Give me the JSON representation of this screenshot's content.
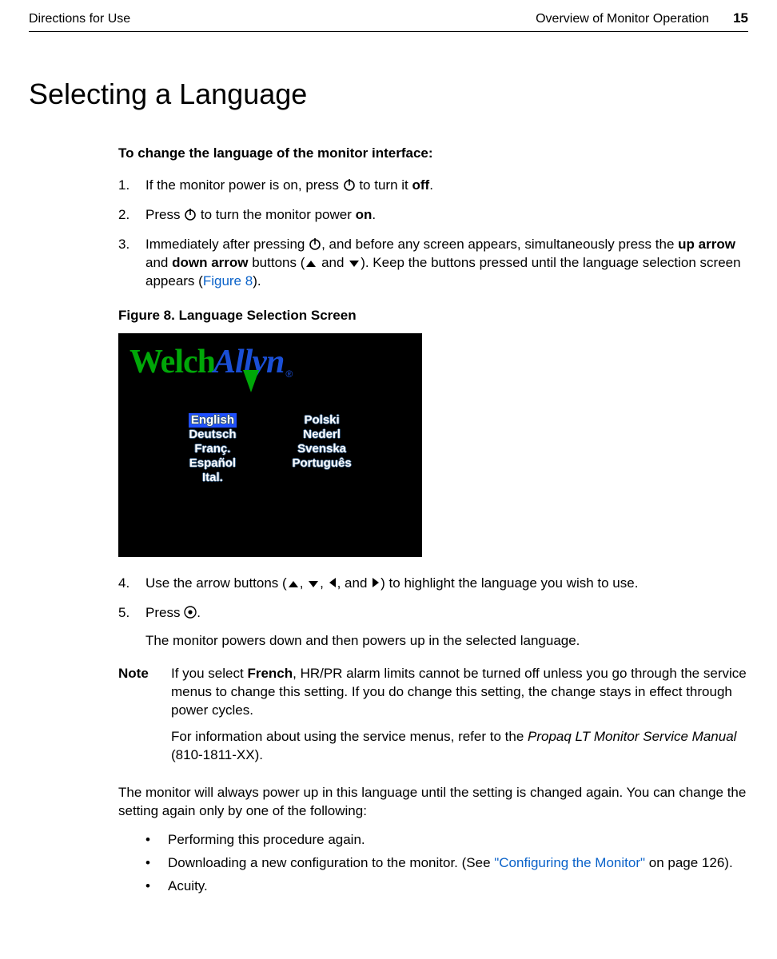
{
  "header": {
    "left": "Directions for Use",
    "right": "Overview of Monitor Operation",
    "pagenum": "15"
  },
  "title": "Selecting a Language",
  "intro": "To change the language of the monitor interface:",
  "steps": {
    "s1": {
      "num": "1.",
      "pre": "If the monitor power is on, press ",
      "post": " to turn it ",
      "bold": "off",
      "end": "."
    },
    "s2": {
      "num": "2.",
      "pre": "Press ",
      "post": " to turn the monitor power ",
      "bold": "on",
      "end": "."
    },
    "s3": {
      "num": "3.",
      "a": "Immediately after pressing ",
      "b": ", and before any screen appears, simultaneously press the ",
      "bold1": "up arrow",
      "c": " and ",
      "bold2": "down arrow",
      "d": " buttons (",
      "e": " and ",
      "f": "). Keep the buttons pressed until the language selection screen appears (",
      "link": "Figure 8",
      "g": ")."
    },
    "s4": {
      "num": "4.",
      "a": "Use the arrow buttons (",
      "b": ", ",
      "c": ", ",
      "d": ", and ",
      "e": ") to highlight the language you wish to use."
    },
    "s5": {
      "num": "5.",
      "a": "Press ",
      "b": ".",
      "sub": "The monitor powers down and then powers up in the selected language."
    }
  },
  "figcap": {
    "label": "Figure 8.  ",
    "title": "Language Selection Screen"
  },
  "logo": {
    "welch": "Welch",
    "allyn": "Allyn",
    "reg": "®"
  },
  "langs": {
    "col1": [
      "English",
      "Deutsch",
      "Franç.",
      "Español",
      "Ital."
    ],
    "col2": [
      "Polski",
      "Nederl",
      "Svenska",
      "Português"
    ]
  },
  "note": {
    "label": "Note",
    "p1a": "If you select ",
    "p1bold": "French",
    "p1b": ", HR/PR alarm limits cannot be turned off unless you go through the service menus to change this setting. If you do change this setting, the change stays in effect through power cycles.",
    "p2a": "For information about using the service menus, refer to the ",
    "p2ital": "Propaq LT Monitor Service Manual",
    "p2b": " (810-1811-XX)."
  },
  "closing": "The monitor will always power up in this language until the setting is changed again. You can change the setting again only by one of the following:",
  "bullets": {
    "b1": "Performing this procedure again.",
    "b2a": "Downloading a new configuration to the monitor. (See ",
    "b2link": "\"Configuring the Monitor\"",
    "b2b": " on page 126).",
    "b3": "Acuity."
  }
}
